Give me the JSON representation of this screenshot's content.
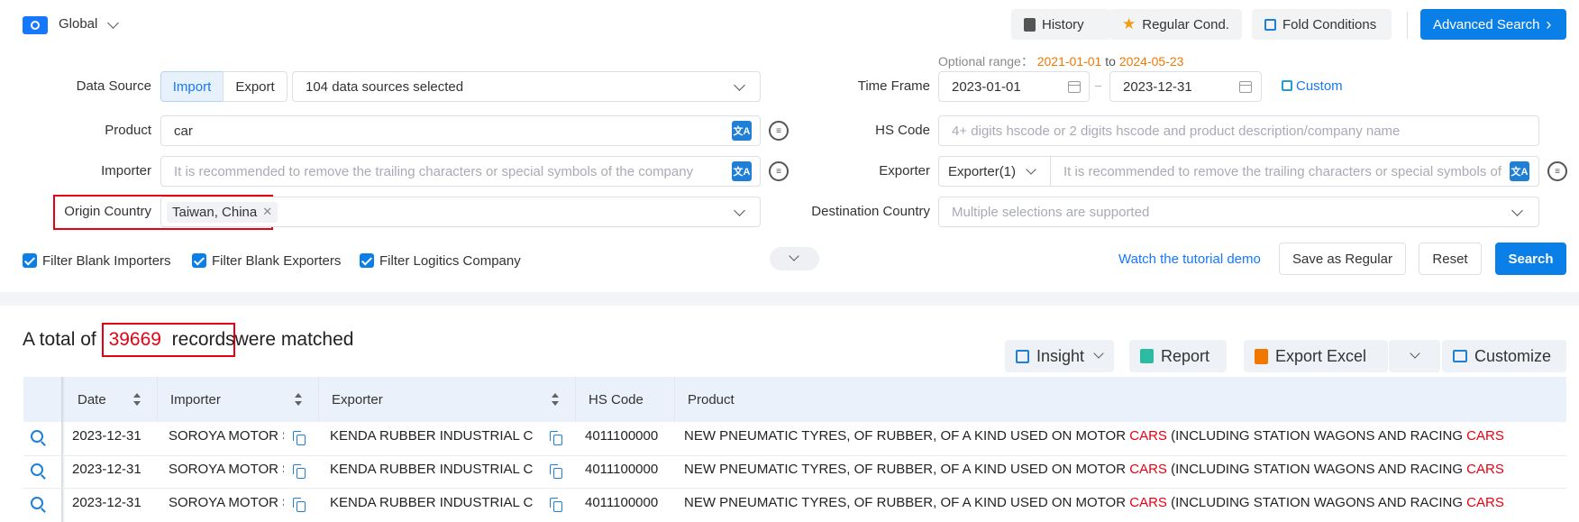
{
  "header": {
    "scope": "Global",
    "buttons": {
      "history": "History",
      "regular": "Regular Cond.",
      "fold": "Fold Conditions",
      "advanced": "Advanced Search"
    }
  },
  "form": {
    "optional_range": {
      "label": "Optional range：",
      "from": "2021-01-01",
      "to_word": "to",
      "to": "2024-05-23"
    },
    "data_source": {
      "label": "Data Source",
      "import": "Import",
      "export": "Export",
      "selected": "104 data sources selected"
    },
    "product": {
      "label": "Product",
      "value": "car"
    },
    "importer": {
      "label": "Importer",
      "placeholder": "It is recommended to remove the trailing characters or special symbols of the company"
    },
    "origin_country": {
      "label": "Origin Country",
      "tag": "Taiwan, China"
    },
    "time_frame": {
      "label": "Time Frame",
      "start": "2023-01-01",
      "sep": "–",
      "end": "2023-12-31",
      "custom": "Custom"
    },
    "hs_code": {
      "label": "HS Code",
      "placeholder": "4+ digits hscode or 2 digits hscode and product description/company name"
    },
    "exporter": {
      "label": "Exporter",
      "select": "Exporter(1)",
      "placeholder": "It is recommended to remove the trailing characters or special symbols of"
    },
    "destination_country": {
      "label": "Destination Country",
      "placeholder": "Multiple selections are supported"
    },
    "filters": [
      "Filter Blank Importers",
      "Filter Blank Exporters",
      "Filter Logitics Company"
    ],
    "tutorial": "Watch the tutorial demo",
    "save_regular": "Save as Regular",
    "reset": "Reset",
    "search": "Search"
  },
  "results": {
    "prefix": "A total of",
    "count": "39669",
    "records": "records",
    "suffix": "were matched",
    "actions": {
      "insight": "Insight",
      "report": "Report",
      "export_excel": "Export Excel",
      "customize": "Customize"
    }
  },
  "table": {
    "columns": [
      "Date",
      "Importer",
      "Exporter",
      "HS Code",
      "Product"
    ],
    "rows": [
      {
        "date": "2023-12-31",
        "importer": "SOROYA MOTOR S",
        "exporter": "KENDA RUBBER INDUSTRIAL CO.,",
        "hs": "4011100000",
        "p1": "NEW PNEUMATIC TYRES, OF RUBBER, OF A KIND USED ON MOTOR ",
        "p2": "CARS",
        "p3": " (INCLUDING STATION WAGONS AND RACING ",
        "p4": "CARS"
      },
      {
        "date": "2023-12-31",
        "importer": "SOROYA MOTOR S",
        "exporter": "KENDA RUBBER INDUSTRIAL CO.,",
        "hs": "4011100000",
        "p1": "NEW PNEUMATIC TYRES, OF RUBBER, OF A KIND USED ON MOTOR ",
        "p2": "CARS",
        "p3": " (INCLUDING STATION WAGONS AND RACING ",
        "p4": "CARS"
      },
      {
        "date": "2023-12-31",
        "importer": "SOROYA MOTOR S",
        "exporter": "KENDA RUBBER INDUSTRIAL CO.,",
        "hs": "4011100000",
        "p1": "NEW PNEUMATIC TYRES, OF RUBBER, OF A KIND USED ON MOTOR ",
        "p2": "CARS",
        "p3": " (INCLUDING STATION WAGONS AND RACING ",
        "p4": "CARS"
      }
    ]
  },
  "colors": {
    "accent": "#0b7fe8",
    "highlight_box": "#e60012",
    "orange_date": "#f07800"
  }
}
